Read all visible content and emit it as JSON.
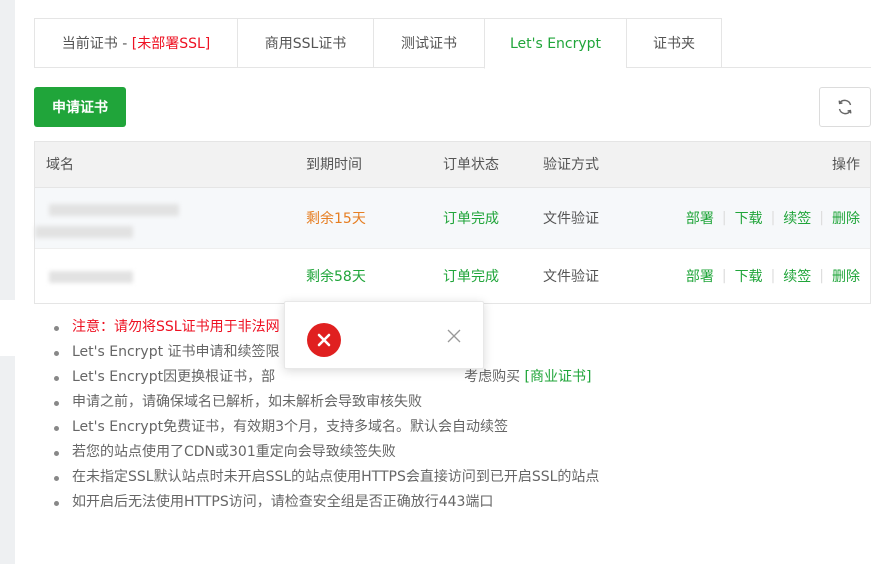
{
  "tabs": [
    {
      "label": "当前证书 -",
      "danger": "[未部署SSL]"
    },
    {
      "label": "商用SSL证书"
    },
    {
      "label": "测试证书"
    },
    {
      "label": "Let's Encrypt"
    },
    {
      "label": "证书夹"
    }
  ],
  "toolbar": {
    "apply_label": "申请证书",
    "refresh_icon": "refresh-icon"
  },
  "table": {
    "columns": [
      "域名",
      "到期时间",
      "订单状态",
      "验证方式",
      "操作"
    ],
    "rows": [
      {
        "expiry": "剩余15天",
        "status": "订单完成",
        "verify": "文件验证",
        "actions": [
          "部署",
          "下载",
          "续签",
          "删除"
        ]
      },
      {
        "expiry": "剩余58天",
        "status": "订单完成",
        "verify": "文件验证",
        "actions": [
          "部署",
          "下载",
          "续签",
          "删除"
        ]
      }
    ]
  },
  "notes": [
    "注意：请勿将SSL证书用于非法网",
    "Let's Encrypt 证书申请和续签限",
    "Let's Encrypt因更换根证书，部",
    "[商业证书]",
    "申请之前，请确保域名已解析，如未解析会导致审核失败",
    "Let's Encrypt免费证书，有效期3个月，支持多域名。默认会自动续签",
    "若您的站点使用了CDN或301重定向会导致续签失败",
    "在未指定SSL默认站点时未开启SSL的站点使用HTTPS会直接访问到已开启SSL的站点",
    "如开启后无法使用HTTPS访问，请检查安全组是否正确放行443端口"
  ],
  "notes_fragments": {
    "note3_tail": "考虑购买"
  },
  "popup": {
    "icon": "error-icon",
    "close_icon": "close-icon"
  },
  "colors": {
    "accent": "#20a53a",
    "danger": "#e12",
    "warning": "#e67e22"
  }
}
